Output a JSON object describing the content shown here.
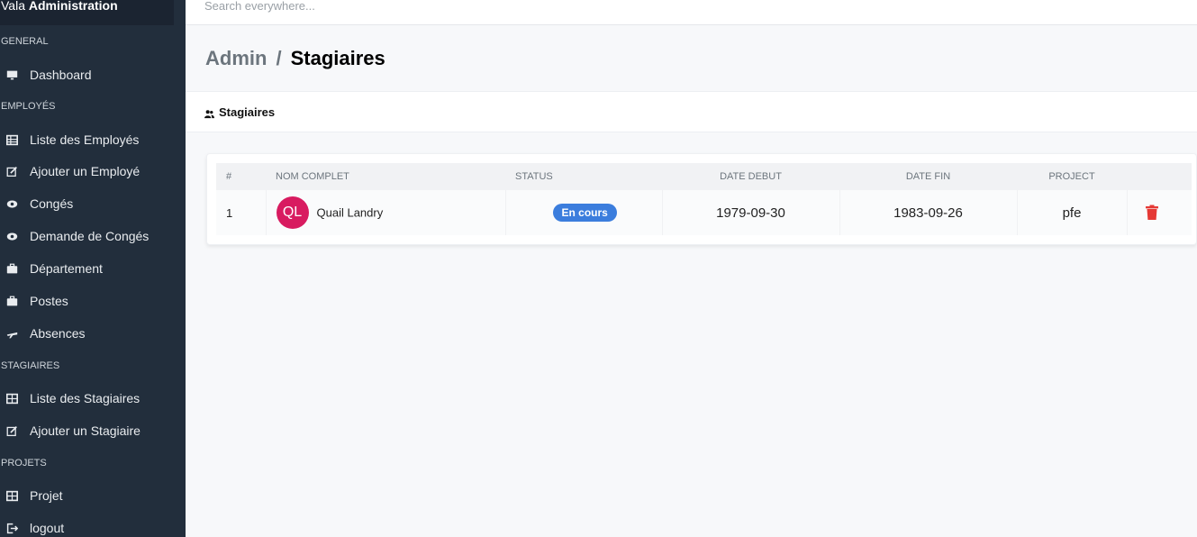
{
  "brand": {
    "prefix": "Vala",
    "name": "Administration"
  },
  "search": {
    "placeholder": "Search everywhere..."
  },
  "sidebar": {
    "sections": [
      {
        "label": "GENERAL"
      },
      {
        "label": "EMPLOYÉS"
      },
      {
        "label": "STAGIAIRES"
      },
      {
        "label": "PROJETS"
      }
    ],
    "items": [
      {
        "label": "Dashboard",
        "icon": "monitor-icon"
      },
      {
        "label": "Liste des Employés",
        "icon": "table-icon"
      },
      {
        "label": "Ajouter un Employé",
        "icon": "edit-icon"
      },
      {
        "label": "Congés",
        "icon": "eye-icon"
      },
      {
        "label": "Demande de Congés",
        "icon": "eye-icon"
      },
      {
        "label": "Département",
        "icon": "briefcase-icon"
      },
      {
        "label": "Postes",
        "icon": "briefcase-icon"
      },
      {
        "label": "Absences",
        "icon": "plane-icon"
      },
      {
        "label": "Liste des Stagiaires",
        "icon": "table-icon"
      },
      {
        "label": "Ajouter un Stagiaire",
        "icon": "edit-icon"
      },
      {
        "label": "Projet",
        "icon": "table-icon"
      },
      {
        "label": "logout",
        "icon": "logout-icon"
      }
    ]
  },
  "breadcrumb": {
    "parent": "Admin",
    "separator": "/",
    "current": "Stagiaires"
  },
  "card": {
    "title": "Stagiaires",
    "icon": "users-icon"
  },
  "table": {
    "headers": [
      "#",
      "NOM COMPLET",
      "STATUS",
      "DATE DEBUT",
      "DATE FIN",
      "PROJECT",
      ""
    ],
    "rows": [
      {
        "index": "1",
        "initials": "QL",
        "name": "Quail Landry",
        "status": "En cours",
        "date_debut": "1979-09-30",
        "date_fin": "1983-09-26",
        "project": "pfe"
      }
    ]
  },
  "colors": {
    "sidebar": "#222e3c",
    "primary": "#3b7ddd",
    "avatar": "#d81b60",
    "danger": "#e53935"
  }
}
